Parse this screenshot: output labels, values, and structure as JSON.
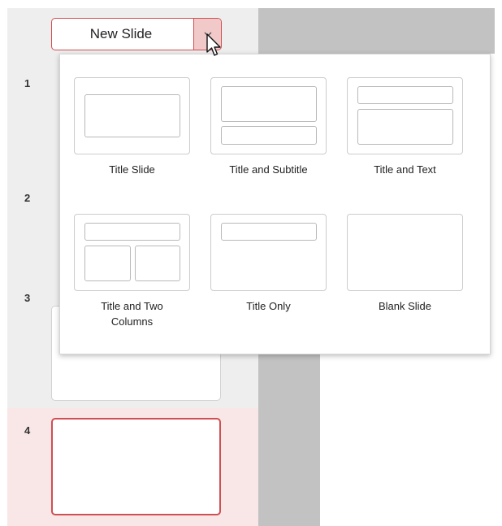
{
  "toolbar": {
    "new_slide_label": "New Slide",
    "dropdown_icon": "chevron-down-icon"
  },
  "colors": {
    "accent": "#cf4f52",
    "accent_light": "#f1c9c9",
    "selected_row": "#f9e6e6",
    "panel": "#eeeeee",
    "canvas": "#c2c2c2"
  },
  "slides": [
    {
      "number": "1"
    },
    {
      "number": "2"
    },
    {
      "number": "3"
    },
    {
      "number": "4",
      "selected": true
    }
  ],
  "layout_menu": {
    "items": [
      {
        "label": "Title Slide"
      },
      {
        "label": "Title and Subtitle"
      },
      {
        "label": "Title and Text"
      },
      {
        "label": "Title and Two Columns"
      },
      {
        "label": "Title Only"
      },
      {
        "label": "Blank Slide"
      }
    ]
  }
}
